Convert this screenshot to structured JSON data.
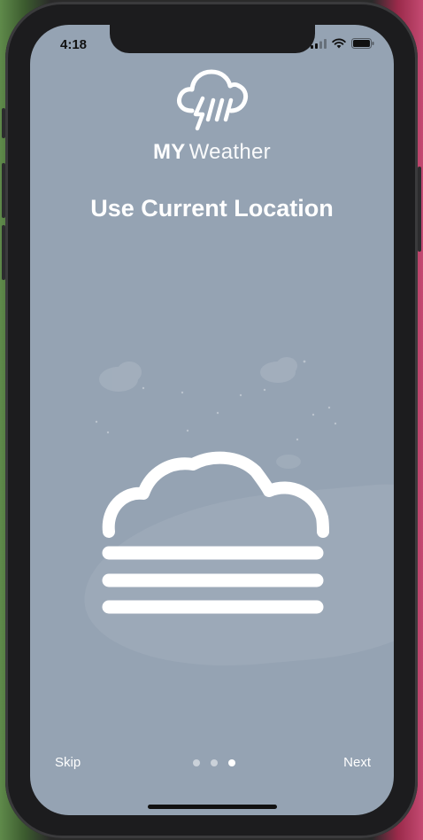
{
  "status_bar": {
    "time": "4:18",
    "icons": [
      "signal-icon",
      "wifi-icon",
      "battery-icon"
    ]
  },
  "app": {
    "brand_bold": "MY",
    "brand_light": "Weather",
    "logo_icon": "rain-storm-cloud-icon"
  },
  "onboarding": {
    "title": "Use Current Location",
    "illustration_icon": "fog-cloud-icon",
    "pages_total": 3,
    "current_page": 3
  },
  "navigation": {
    "skip_label": "Skip",
    "next_label": "Next"
  },
  "colors": {
    "screen_background": "#95a3b3",
    "foreground": "#ffffff"
  }
}
